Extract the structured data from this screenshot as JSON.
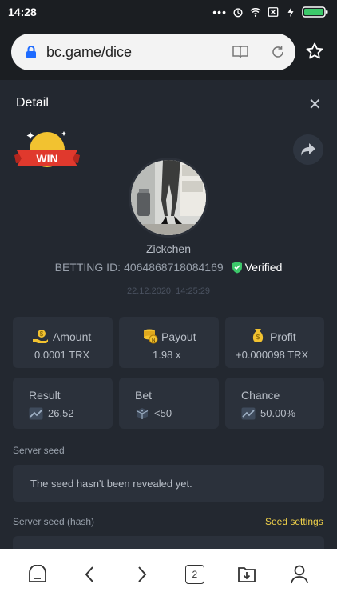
{
  "status": {
    "time": "14:28"
  },
  "browser": {
    "url": "bc.game/dice"
  },
  "detail": {
    "title": "Detail",
    "win_label": "WIN",
    "username": "Zickchen",
    "betting_id_label": "BETTING ID:",
    "betting_id": "4064868718084169",
    "verified": "Verified",
    "datetime": "22.12.2020, 14:25:29"
  },
  "stats": {
    "amount_label": "Amount",
    "amount_value": "0.0001 TRX",
    "payout_label": "Payout",
    "payout_value": "1.98 x",
    "profit_label": "Profit",
    "profit_value": "+0.000098 TRX",
    "result_label": "Result",
    "result_value": "26.52",
    "bet_label": "Bet",
    "bet_value": "<50",
    "chance_label": "Chance",
    "chance_value": "50.00%"
  },
  "seed": {
    "server_seed_label": "Server seed",
    "server_seed_text": "The seed hasn't been revealed yet.",
    "server_seed_hash_label": "Server seed (hash)",
    "seed_settings": "Seed settings"
  },
  "nav": {
    "tabs_count": "2"
  },
  "colors": {
    "accent": "#f0d14a",
    "verified": "#3cc86a",
    "panel": "#232830",
    "card": "#2b313b"
  }
}
